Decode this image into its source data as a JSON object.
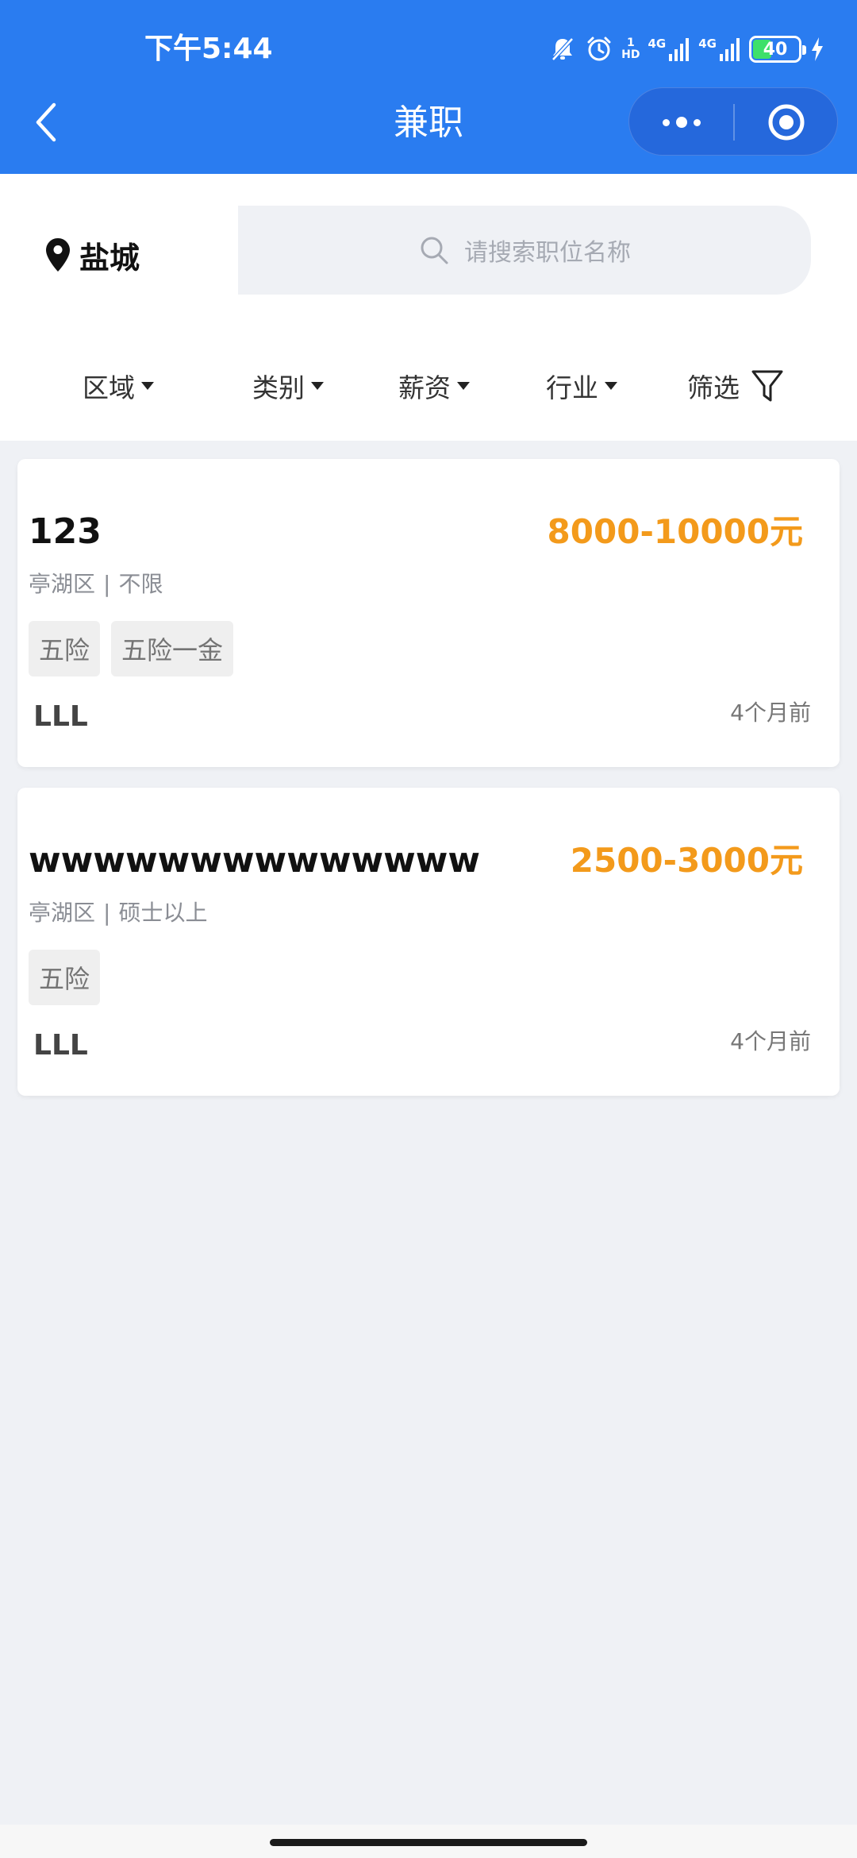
{
  "status_bar": {
    "time": "下午5:44",
    "signal_1_label": "4G",
    "signal_2_label": "4G",
    "battery_level": "40",
    "hd_top": "1",
    "hd_bottom": "HD"
  },
  "nav": {
    "title": "兼职"
  },
  "location": {
    "city": "盐城"
  },
  "search": {
    "placeholder": "请搜索职位名称"
  },
  "filters": {
    "tabs": [
      {
        "label": "区域"
      },
      {
        "label": "类别"
      },
      {
        "label": "薪资"
      },
      {
        "label": "行业"
      },
      {
        "label": "筛选"
      }
    ]
  },
  "jobs": [
    {
      "title": "123",
      "salary": "8000-10000元",
      "district": "亭湖区",
      "separator": "|",
      "requirement": "不限",
      "tags": [
        "五险",
        "五险一金"
      ],
      "company": "LLL",
      "posted": "4个月前"
    },
    {
      "title": "wwwwwwwwwwwwww",
      "salary": "2500-3000元",
      "district": "亭湖区",
      "separator": "|",
      "requirement": "硕士以上",
      "tags": [
        "五险"
      ],
      "company": "LLL",
      "posted": "4个月前"
    }
  ],
  "colors": {
    "primary": "#2a7cf0",
    "salary": "#f39a1b",
    "page_bg": "#eff1f5"
  }
}
